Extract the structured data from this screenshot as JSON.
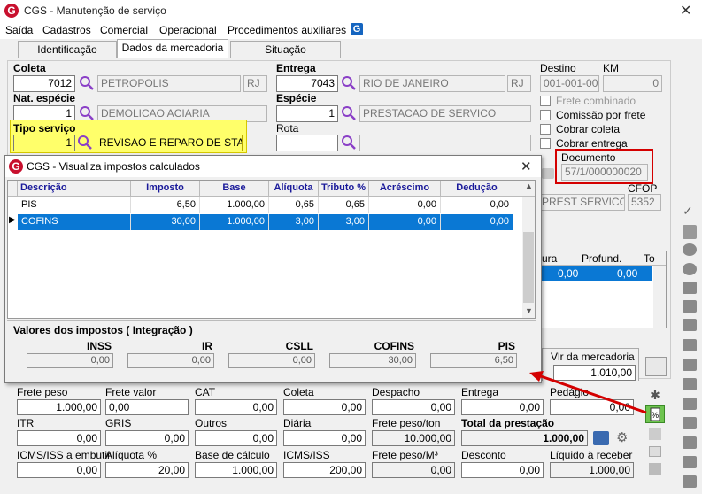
{
  "window": {
    "title": "CGS - Manutenção de serviço",
    "close": "✕"
  },
  "menu": [
    "Saída",
    "Cadastros",
    "Comercial",
    "Operacional",
    "Procedimentos auxiliares"
  ],
  "tabs": [
    "Identificação",
    "Dados da mercadoria",
    "Situação"
  ],
  "form": {
    "coleta_label": "Coleta",
    "coleta_code": "7012",
    "coleta_city": "PETROPOLIS",
    "coleta_uf": "RJ",
    "entrega_label": "Entrega",
    "entrega_code": "7043",
    "entrega_city": "RIO DE JANEIRO",
    "entrega_uf": "RJ",
    "destino_label": "Destino",
    "destino_value": "001-001-001",
    "km_label": "KM",
    "km_value": "0",
    "nat_label": "Nat. espécie",
    "nat_code": "1",
    "nat_desc": "DEMOLICAO ACIARIA",
    "especie_label": "Espécie",
    "especie_code": "1",
    "especie_desc": "PRESTACAO DE SERVICO",
    "tipo_label": "Tipo serviço",
    "tipo_code": "1",
    "tipo_desc": "REVISAO E REPARO DE STAND",
    "rota_label": "Rota",
    "frete_combinado": "Frete combinado",
    "comissao": "Comissão por frete",
    "cobrar_coleta": "Cobrar coleta",
    "cobrar_entrega": "Cobrar entrega",
    "documento_label": "Documento",
    "documento_value": "57/1/000000020",
    "cfop_label": "CFOP",
    "natop_value": "PREST SERVICO T",
    "cfop_value": "5352",
    "lura_header": "ura",
    "profund_header": "Profund.",
    "to_header": "To",
    "lura_value": "0,00",
    "profund_value": "0,00",
    "vlr_merc_label": "Vlr da mercadoria",
    "vlr_merc_value": "1.010,00"
  },
  "dialog": {
    "title": "CGS - Visualiza impostos calculados",
    "close": "✕",
    "columns": [
      "Descrição",
      "Imposto",
      "Base",
      "Alíquota",
      "Tributo %",
      "Acréscimo",
      "Dedução"
    ],
    "rows": [
      [
        "PIS",
        "6,50",
        "1.000,00",
        "0,65",
        "0,65",
        "0,00",
        "0,00"
      ],
      [
        "COFINS",
        "30,00",
        "1.000,00",
        "3,00",
        "3,00",
        "0,00",
        "0,00"
      ]
    ],
    "section_title": "Valores dos impostos ( Integração )",
    "values": [
      {
        "label": "INSS",
        "value": "0,00"
      },
      {
        "label": "IR",
        "value": "0,00"
      },
      {
        "label": "CSLL",
        "value": "0,00"
      },
      {
        "label": "COFINS",
        "value": "30,00"
      },
      {
        "label": "PIS",
        "value": "6,50"
      }
    ]
  },
  "bottom": {
    "row1": [
      {
        "label": "Frete peso",
        "value": "1.000,00"
      },
      {
        "label": "Frete valor",
        "value": "0,00"
      },
      {
        "label": "CAT",
        "value": "0,00"
      },
      {
        "label": "Coleta",
        "value": "0,00"
      },
      {
        "label": "Despacho",
        "value": "0,00"
      },
      {
        "label": "Entrega",
        "value": "0,00"
      },
      {
        "label": "Pedágio",
        "value": "0,00"
      }
    ],
    "row2": [
      {
        "label": "ITR",
        "value": "0,00"
      },
      {
        "label": "GRIS",
        "value": "0,00"
      },
      {
        "label": "Outros",
        "value": "0,00"
      },
      {
        "label": "Diária",
        "value": "0,00"
      },
      {
        "label": "Frete peso/ton",
        "value": "10.000,00"
      },
      {
        "label": "Total da prestação",
        "value": "1.000,00"
      }
    ],
    "row3": [
      {
        "label": "ICMS/ISS a embutir",
        "value": "0,00"
      },
      {
        "label": "Alíquota %",
        "value": "20,00"
      },
      {
        "label": "Base de cálculo",
        "value": "1.000,00"
      },
      {
        "label": "ICMS/ISS",
        "value": "200,00"
      },
      {
        "label": "Frete peso/M³",
        "value": "0,00"
      },
      {
        "label": "Desconto",
        "value": "0,00"
      },
      {
        "label": "Líquido à receber",
        "value": "1.000,00"
      }
    ]
  },
  "accent": {
    "yellow": "#ffff6a",
    "red": "#d40000",
    "select": "#0a78d4",
    "header_text": "#1a1a9a"
  }
}
